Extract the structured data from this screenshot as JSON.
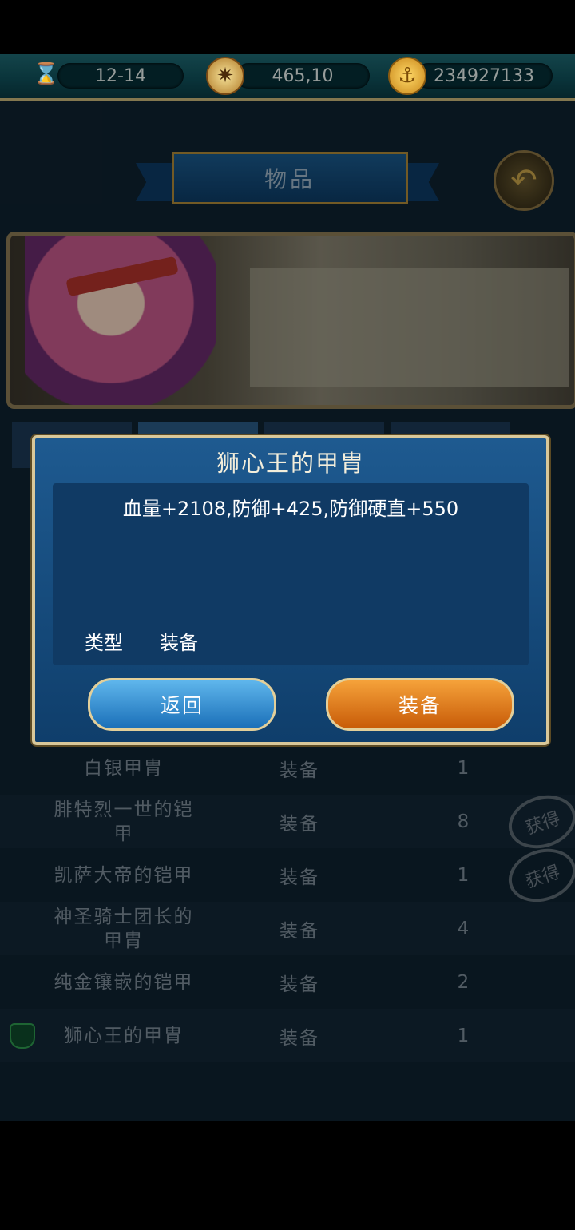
{
  "topbar": {
    "date": "12-14",
    "coordinates": "465,10",
    "gold": "234927133",
    "icons": [
      "hourglass-icon",
      "compass-icon",
      "gold-coin-icon"
    ]
  },
  "header": {
    "title": "物品",
    "back_icon": "back-arrow-icon"
  },
  "item_list": {
    "rows": [
      {
        "name": "白银甲胄",
        "type": "装备",
        "qty": "1",
        "obtained": false
      },
      {
        "name": "腓特烈一世的铠\n甲",
        "type": "装备",
        "qty": "8",
        "obtained": true
      },
      {
        "name": "凯萨大帝的铠甲",
        "type": "装备",
        "qty": "1",
        "obtained": true
      },
      {
        "name": "神圣骑士团长的\n甲胄",
        "type": "装备",
        "qty": "4",
        "obtained": false
      },
      {
        "name": "纯金镶嵌的铠甲",
        "type": "装备",
        "qty": "2",
        "obtained": false
      },
      {
        "name": "狮心王的甲胄",
        "type": "装备",
        "qty": "1",
        "obtained": false,
        "equipped": true
      }
    ],
    "stamp_text": "获得"
  },
  "dialog": {
    "title": "狮心王的甲胄",
    "description": "血量+2108,防御+425,防御硬直+550",
    "type_label": "类型",
    "type_value": "装备",
    "back_button": "返回",
    "equip_button": "装备"
  },
  "colors": {
    "accent_gold": "#d9c89a",
    "dialog_blue": "#1e5a90",
    "equip_orange": "#f5a23a",
    "back_blue": "#5fb6ec"
  }
}
